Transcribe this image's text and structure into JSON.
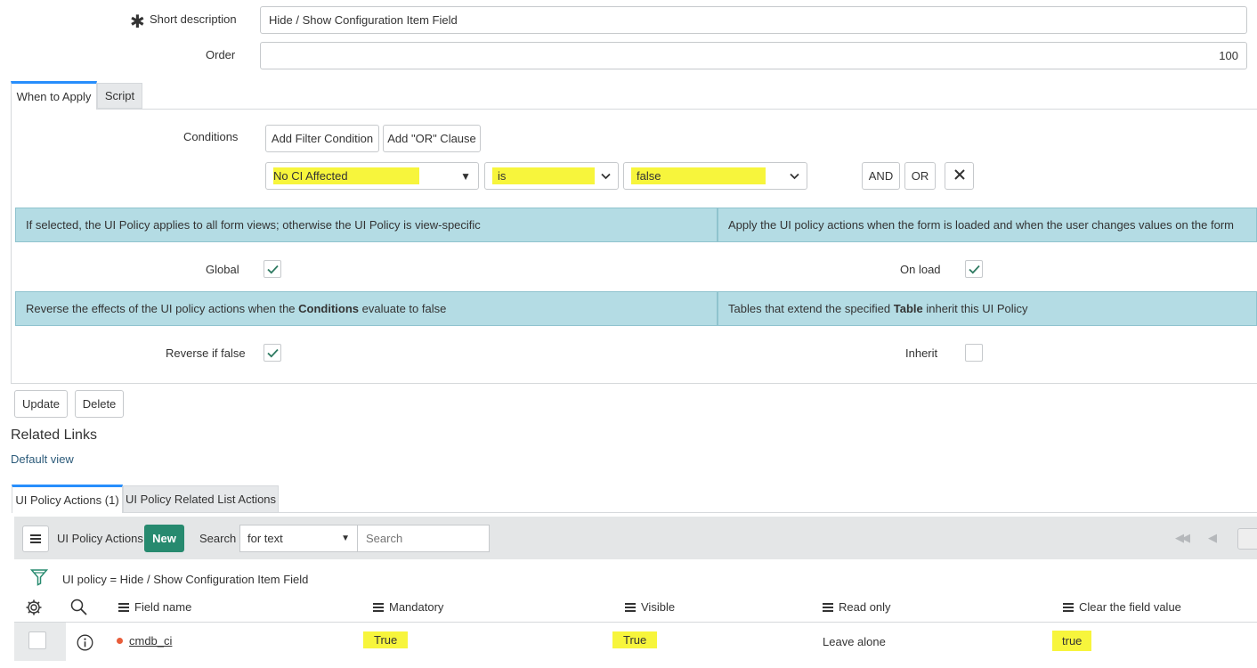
{
  "form": {
    "short_description": {
      "label": "Short description",
      "value": "Hide / Show Configuration Item Field"
    },
    "order": {
      "label": "Order",
      "value": "100"
    }
  },
  "tabs": [
    {
      "label": "When to Apply"
    },
    {
      "label": "Script"
    }
  ],
  "conditions": {
    "label": "Conditions",
    "add_filter_label": "Add Filter Condition",
    "add_or_label": "Add \"OR\" Clause",
    "field": "No CI Affected",
    "operator": "is",
    "value": "false",
    "and_label": "AND",
    "or_label": "OR"
  },
  "info": {
    "global": "If selected, the UI Policy applies to all form views; otherwise the UI Policy is view-specific",
    "onload": "Apply the UI policy actions when the form is loaded and when the user changes values on the form",
    "reverse_pre": "Reverse the effects of the UI policy actions when the ",
    "reverse_bold": "Conditions",
    "reverse_post": " evaluate to false",
    "inherit_pre": "Tables that extend the specified ",
    "inherit_bold": "Table",
    "inherit_post": " inherit this UI Policy"
  },
  "options": {
    "global": {
      "label": "Global",
      "checked": true
    },
    "onload": {
      "label": "On load",
      "checked": true
    },
    "reverse": {
      "label": "Reverse if false",
      "checked": true
    },
    "inherit": {
      "label": "Inherit",
      "checked": false
    }
  },
  "actions": {
    "update_label": "Update",
    "delete_label": "Delete"
  },
  "related_links": {
    "title": "Related Links",
    "default_view": "Default view"
  },
  "related_tabs": [
    {
      "label": "UI Policy Actions (1)"
    },
    {
      "label": "UI Policy Related List Actions"
    }
  ],
  "list": {
    "title": "UI Policy Actions",
    "new_label": "New",
    "search_label": "Search",
    "search_field": "for text",
    "search_placeholder": "Search",
    "filter_text": "UI policy = Hide / Show Configuration Item Field",
    "columns": [
      "Field name",
      "Mandatory",
      "Visible",
      "Read only",
      "Clear the field value"
    ],
    "rows": [
      {
        "field_name": "cmdb_ci",
        "mandatory": "True",
        "visible": "True",
        "read_only": "Leave alone",
        "clear_value": "true"
      }
    ]
  },
  "colors": {
    "accent": "#278efc",
    "new_button": "#278a6f",
    "info_bg": "#b4dce4",
    "highlight": "#f7f53c",
    "check": "#2e7a61",
    "link": "#2c5b7a"
  }
}
